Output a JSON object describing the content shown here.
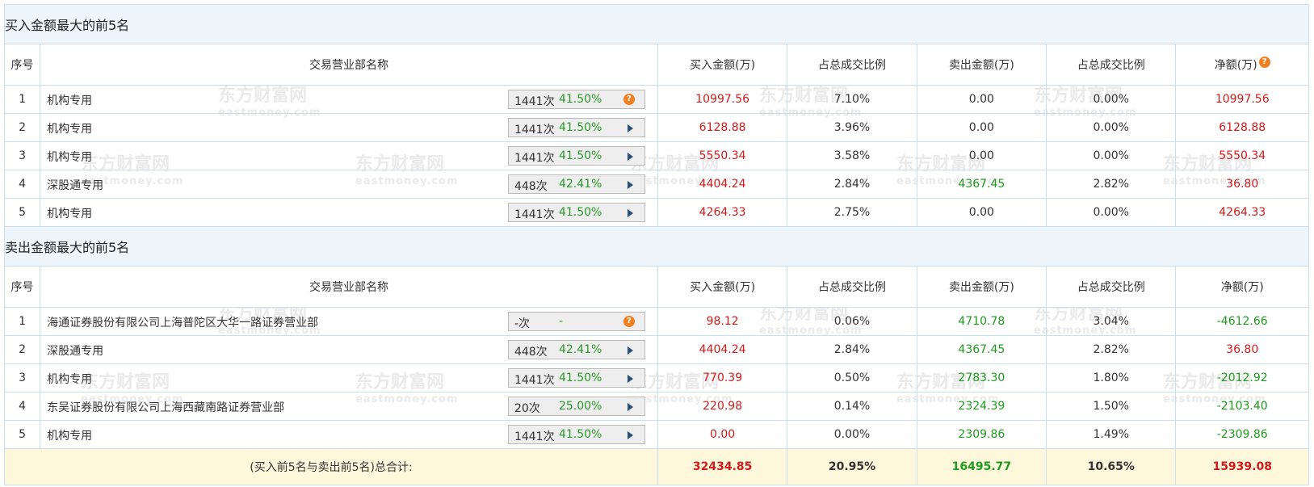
{
  "buy_section": {
    "title": "买入金额最大的前5名",
    "headers": [
      "序号",
      "交易营业部名称",
      "买入金额(万)",
      "占总成交比例",
      "卖出金额(万)",
      "占总成交比例",
      "净额(万)"
    ],
    "net_help_icon": "help-icon",
    "rows": [
      {
        "idx": "1",
        "name": "机构专用",
        "count": "1441次",
        "rate": "41.50%",
        "stat_icon": "help-icon",
        "buy": "10997.56",
        "buy_pct": "7.10%",
        "sell": "0.00",
        "sell_pct": "0.00%",
        "net": "10997.56"
      },
      {
        "idx": "2",
        "name": "机构专用",
        "count": "1441次",
        "rate": "41.50%",
        "stat_icon": "play-arrow-icon",
        "buy": "6128.88",
        "buy_pct": "3.96%",
        "sell": "0.00",
        "sell_pct": "0.00%",
        "net": "6128.88"
      },
      {
        "idx": "3",
        "name": "机构专用",
        "count": "1441次",
        "rate": "41.50%",
        "stat_icon": "play-arrow-icon",
        "buy": "5550.34",
        "buy_pct": "3.58%",
        "sell": "0.00",
        "sell_pct": "0.00%",
        "net": "5550.34"
      },
      {
        "idx": "4",
        "name": "深股通专用",
        "count": "448次",
        "rate": "42.41%",
        "stat_icon": "play-arrow-icon",
        "buy": "4404.24",
        "buy_pct": "2.84%",
        "sell": "4367.45",
        "sell_pct": "2.82%",
        "net": "36.80"
      },
      {
        "idx": "5",
        "name": "机构专用",
        "count": "1441次",
        "rate": "41.50%",
        "stat_icon": "play-arrow-icon",
        "buy": "4264.33",
        "buy_pct": "2.75%",
        "sell": "0.00",
        "sell_pct": "0.00%",
        "net": "4264.33"
      }
    ]
  },
  "sell_section": {
    "title": "卖出金额最大的前5名",
    "headers": [
      "序号",
      "交易营业部名称",
      "买入金额(万)",
      "占总成交比例",
      "卖出金额(万)",
      "占总成交比例",
      "净额(万)"
    ],
    "rows": [
      {
        "idx": "1",
        "name": "海通证券股份有限公司上海普陀区大华一路证券营业部",
        "count": "-次",
        "rate": "-",
        "stat_icon": "help-icon",
        "buy": "98.12",
        "buy_pct": "0.06%",
        "sell": "4710.78",
        "sell_pct": "3.04%",
        "net": "-4612.66"
      },
      {
        "idx": "2",
        "name": "深股通专用",
        "count": "448次",
        "rate": "42.41%",
        "stat_icon": "play-arrow-icon",
        "buy": "4404.24",
        "buy_pct": "2.84%",
        "sell": "4367.45",
        "sell_pct": "2.82%",
        "net": "36.80"
      },
      {
        "idx": "3",
        "name": "机构专用",
        "count": "1441次",
        "rate": "41.50%",
        "stat_icon": "play-arrow-icon",
        "buy": "770.39",
        "buy_pct": "0.50%",
        "sell": "2783.30",
        "sell_pct": "1.80%",
        "net": "-2012.92"
      },
      {
        "idx": "4",
        "name": "东吴证券股份有限公司上海西藏南路证券营业部",
        "count": "20次",
        "rate": "25.00%",
        "stat_icon": "play-arrow-icon",
        "buy": "220.98",
        "buy_pct": "0.14%",
        "sell": "2324.39",
        "sell_pct": "1.50%",
        "net": "-2103.40"
      },
      {
        "idx": "5",
        "name": "机构专用",
        "count": "1441次",
        "rate": "41.50%",
        "stat_icon": "play-arrow-icon",
        "buy": "0.00",
        "buy_pct": "0.00%",
        "sell": "2309.86",
        "sell_pct": "1.49%",
        "net": "-2309.86"
      }
    ]
  },
  "total": {
    "label": "(买入前5名与卖出前5名)总合计:",
    "buy": "32434.85",
    "buy_pct": "20.95%",
    "sell": "16495.77",
    "sell_pct": "10.65%",
    "net": "15939.08"
  },
  "watermark": {
    "brand": "东方财富网",
    "domain": "eastmoney.com"
  },
  "colors": {
    "section_bg": "#eef6fc",
    "border": "#c9dff0",
    "red": "#d21a1a",
    "green": "#1e9a1e",
    "total_bg": "#fdf8dc",
    "help_icon": "#f08020"
  }
}
